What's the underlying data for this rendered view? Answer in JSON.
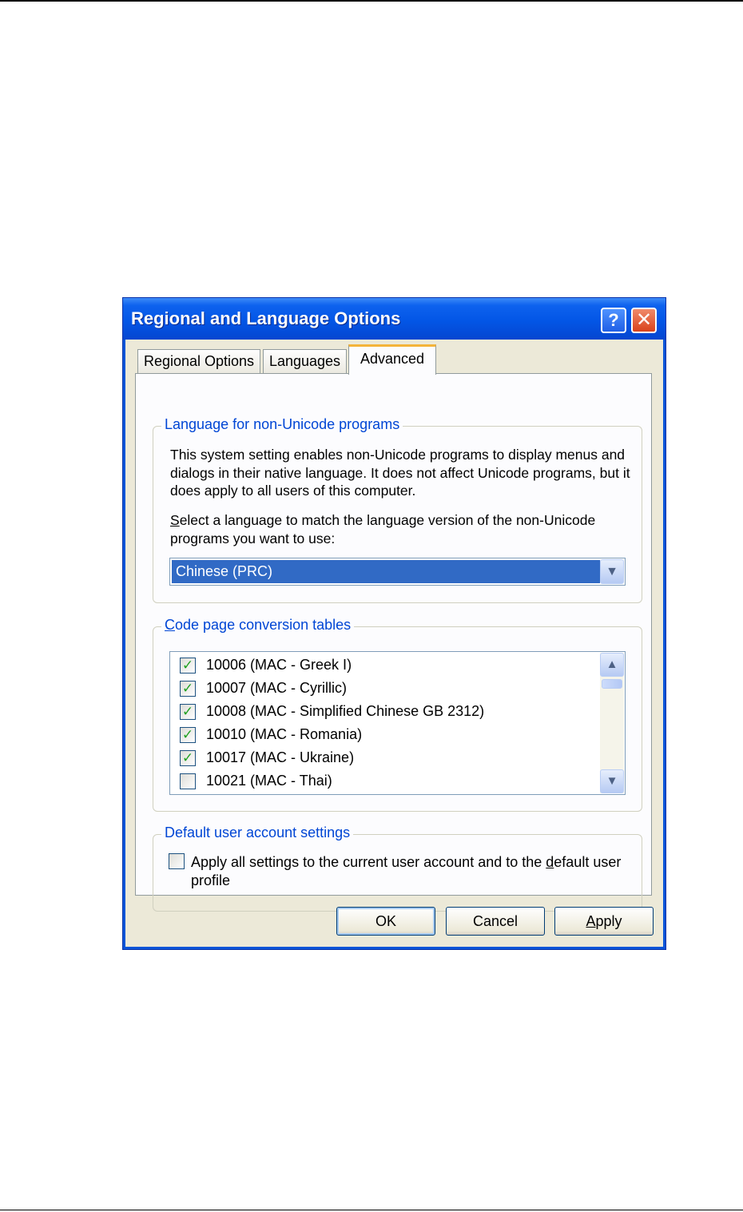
{
  "window": {
    "title": "Regional and Language Options",
    "help_glyph": "?",
    "close_glyph": "✕"
  },
  "tabs": [
    {
      "label": "Regional Options",
      "selected": false
    },
    {
      "label": "Languages",
      "selected": false
    },
    {
      "label": "Advanced",
      "selected": true
    }
  ],
  "non_unicode": {
    "legend": "Language for non-Unicode programs",
    "description": "This system setting enables non-Unicode programs to display menus and dialogs in their native language. It does not affect Unicode programs, but it does apply to all users of this computer.",
    "prompt_first_letter": "S",
    "prompt_rest": "elect a language to match the language version of the non-Unicode programs you want to use:",
    "selected_language": "Chinese (PRC)",
    "dropdown_glyph": "▼"
  },
  "code_pages": {
    "legend_first_letter": "C",
    "legend_rest": "ode page conversion tables",
    "items": [
      {
        "label": "10006 (MAC - Greek I)",
        "checked": true
      },
      {
        "label": "10007 (MAC - Cyrillic)",
        "checked": true
      },
      {
        "label": "10008 (MAC - Simplified Chinese GB 2312)",
        "checked": true
      },
      {
        "label": "10010 (MAC - Romania)",
        "checked": true
      },
      {
        "label": "10017 (MAC - Ukraine)",
        "checked": true
      },
      {
        "label": "10021 (MAC - Thai)",
        "checked": false
      }
    ],
    "check_glyph": "✓",
    "scroll_up_glyph": "▲",
    "scroll_down_glyph": "▼"
  },
  "default_account": {
    "legend": "Default user account settings",
    "label_before": "Apply all settings to the current user account and to the ",
    "label_underlined": "d",
    "label_after": "efault user profile",
    "checked": false
  },
  "buttons": {
    "ok": "OK",
    "cancel": "Cancel",
    "apply_first_letter": "A",
    "apply_rest": "pply"
  }
}
